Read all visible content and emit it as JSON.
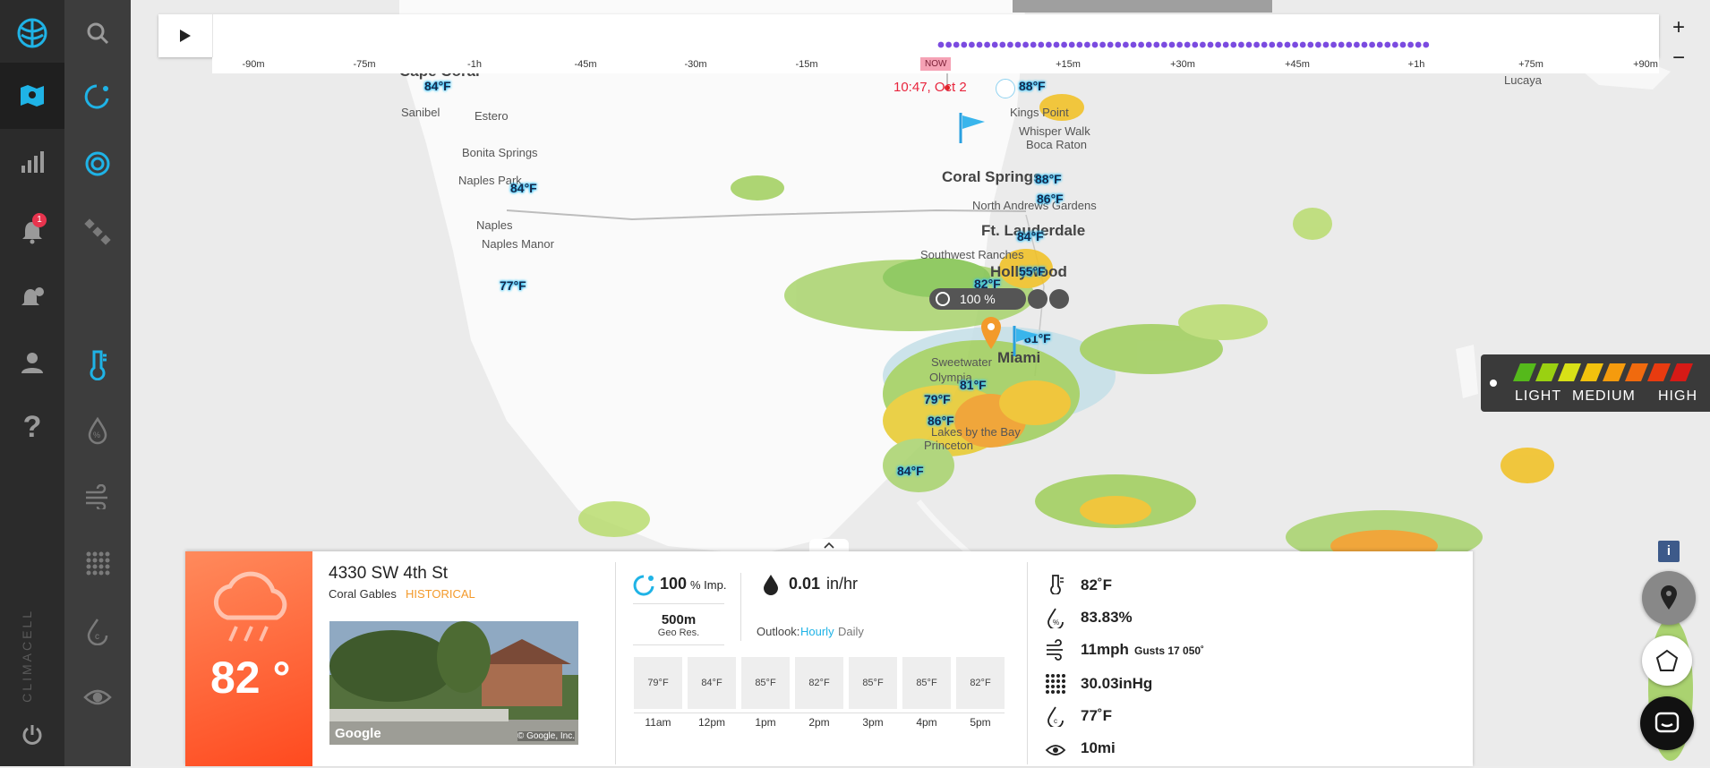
{
  "app": {
    "brand": "CLIMACELL"
  },
  "sidebar": {
    "notification_count": "1"
  },
  "timeline": {
    "ticks": [
      "-90m",
      "-75m",
      "-1h",
      "-45m",
      "-30m",
      "-15m",
      "+15m",
      "+30m",
      "+45m",
      "+1h",
      "+75m",
      "+90m"
    ],
    "now_label": "NOW",
    "now_time": "10:47, Oct 2"
  },
  "zoom": {
    "in_label": "+",
    "out_label": "−"
  },
  "map": {
    "places": [
      "Sanibel",
      "Estero",
      "Bonita Springs",
      "Naples Park",
      "Naples",
      "Naples Manor",
      "Kings Point",
      "Whisper Walk",
      "Boca Raton",
      "North Andrews Gardens",
      "Southwest Ranches",
      "Sweetwater",
      "Olympia",
      "Princeton",
      "Lakes by the Bay",
      "Lucaya"
    ],
    "cities": [
      "Cape Coral",
      "Coral Springs",
      "Ft. Lauderdale",
      "Hollywood",
      "Miami"
    ],
    "temps": [
      "84°F",
      "84°F",
      "77°F",
      "88°F",
      "88°F",
      "86°F",
      "84°F",
      "55°F",
      "82°F",
      "81°F",
      "81°F",
      "79°F",
      "86°F",
      "84°F"
    ],
    "radar_badge": "100 %"
  },
  "legend": {
    "light": "LIGHT",
    "medium": "MEDIUM",
    "high": "HIGH",
    "colors": [
      "#55b91b",
      "#9ad111",
      "#d8e017",
      "#f2c20e",
      "#f59b0d",
      "#f06a0e",
      "#e83b10",
      "#d61a16"
    ]
  },
  "panel": {
    "temperature": "82 °",
    "address": "4330 SW 4th St",
    "city": "Coral Gables",
    "status": "HISTORICAL",
    "photo_credit": "Google",
    "photo_copyright": "© Google, Inc.",
    "impact_value": "100",
    "impact_unit": "% Imp.",
    "precip_value": "0.01",
    "precip_unit": "in/hr",
    "geo_res_value": "500m",
    "geo_res_label": "Geo Res.",
    "outlook_label": "Outlook:",
    "outlook_hourly": "Hourly",
    "outlook_daily": "Daily",
    "hours": [
      {
        "temp": "79°F",
        "time": "11am"
      },
      {
        "temp": "84°F",
        "time": "12pm"
      },
      {
        "temp": "85°F",
        "time": "1pm"
      },
      {
        "temp": "82°F",
        "time": "2pm"
      },
      {
        "temp": "85°F",
        "time": "3pm"
      },
      {
        "temp": "85°F",
        "time": "4pm"
      },
      {
        "temp": "82°F",
        "time": "5pm"
      }
    ],
    "stats": {
      "temp": "82˚F",
      "humidity": "83.83%",
      "wind": "11mph",
      "gusts": "Gusts 17 050˚",
      "pressure": "30.03inHg",
      "dew_point": "77˚F",
      "visibility": "10mi"
    },
    "info_label": "i"
  },
  "colors": {
    "accent": "#1fb3e6",
    "sidebar": "#2b2b2b",
    "historical": "#f39a2b",
    "now": "#e8253d"
  }
}
